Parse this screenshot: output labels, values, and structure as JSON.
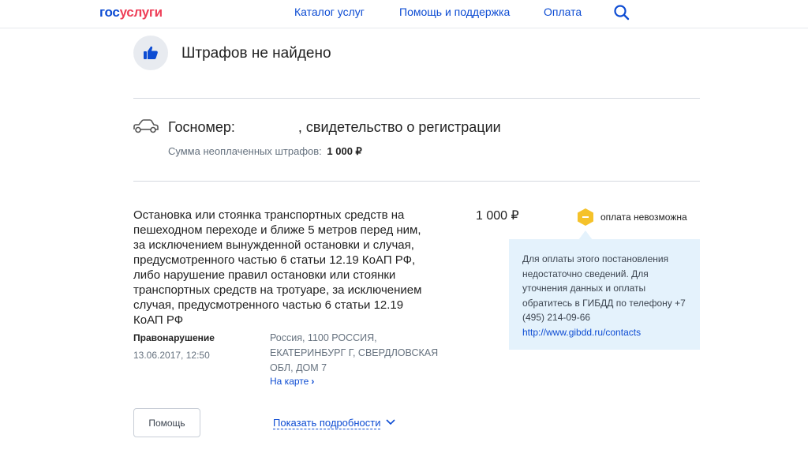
{
  "header": {
    "logo_part1": "гос",
    "logo_part2": "услуги",
    "nav": [
      "Каталог услуг",
      "Помощь и поддержка",
      "Оплата"
    ],
    "search_icon": "magnifier-icon"
  },
  "status": {
    "icon": "thumbs-up-icon",
    "title": "Штрафов не найдено"
  },
  "vehicle": {
    "icon": "car-icon",
    "plate_label": "Госномер:",
    "plate_suffix": ", свидетельство о регистрации",
    "sum_label": "Сумма неоплаченных штрафов:",
    "sum_value": "1 000 ₽"
  },
  "fine": {
    "description": "Остановка или стоянка транспортных средств на пешеходном переходе и ближе 5 метров перед ним, за исключением вынужденной остановки и случая, предусмотренного частью 6 статьи 12.19 КоАП РФ, либо нарушение правил остановки или стоянки транспортных средств на тротуаре, за исключением случая, предусмотренного частью 6 статьи 12.19 КоАП РФ",
    "amount": "1 000 ₽",
    "pay_status": "оплата невозможна",
    "pay_status_color": "#f5c22a",
    "tooltip_text": "Для оплаты этого постановления недостаточно сведений. Для уточнения данных и оплаты обратитесь в ГИБДД по телефону +7 (495) 214-09-66",
    "tooltip_link": "http://www.gibdd.ru/contacts",
    "violation_label": "Правонарушение",
    "violation_date": "13.06.2017, 12:50",
    "address": "Россия, 1100 РОССИЯ, ЕКАТЕРИНБУРГ Г, СВЕРДЛОВСКАЯ ОБЛ, ДОМ 7",
    "map_link": "На карте",
    "help_button": "Помощь",
    "details_link": "Показать подробности"
  },
  "colors": {
    "brand_blue": "#0d4cd3",
    "brand_red": "#ee3f58",
    "tooltip_bg": "#e4f2fc"
  }
}
